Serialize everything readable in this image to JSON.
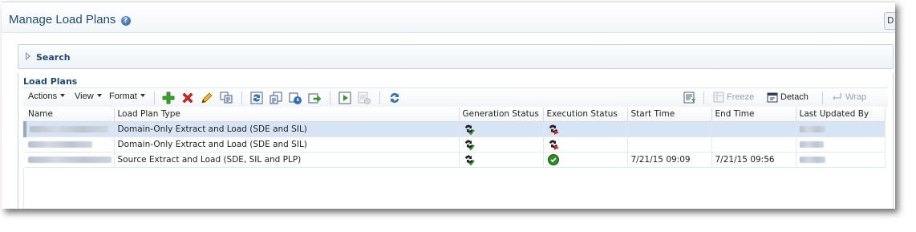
{
  "page": {
    "title": "Manage Load Plans",
    "corner_button_label": "D"
  },
  "search": {
    "label": "Search"
  },
  "load_plans": {
    "title": "Load Plans",
    "menus": [
      {
        "label": "Actions"
      },
      {
        "label": "View"
      },
      {
        "label": "Format"
      }
    ],
    "toolbar_icons": [
      "add-icon",
      "delete-icon",
      "edit-icon",
      "duplicate-icon",
      "generate-icon",
      "copy-icon",
      "schedule-icon",
      "export-icon",
      "execute-icon",
      "stop-icon",
      "refresh-icon"
    ],
    "right_tools": {
      "freeze_label": "Freeze",
      "detach_label": "Detach",
      "wrap_label": "Wrap"
    },
    "columns": [
      "Name",
      "Load Plan Type",
      "Generation Status",
      "Execution Status",
      "Start Time",
      "End Time",
      "Last Updated By"
    ],
    "rows": [
      {
        "type": "Domain-Only Extract and Load (SDE and SIL)",
        "generation_icon": "generation-status-icon",
        "execution_icon": "execution-failed-icon",
        "start": "",
        "end": ""
      },
      {
        "type": "Domain-Only Extract and Load (SDE and SIL)",
        "generation_icon": "generation-status-icon",
        "execution_icon": "execution-failed-icon",
        "start": "",
        "end": ""
      },
      {
        "type": "Source Extract and Load (SDE, SIL and PLP)",
        "generation_icon": "generation-status-icon",
        "execution_icon": "execution-success-icon",
        "start": "7/21/15 09:09",
        "end": "7/21/15 09:56"
      }
    ],
    "colors": {
      "selected_row": "#d7e4f3",
      "title_blue": "#1d4a7a"
    }
  }
}
